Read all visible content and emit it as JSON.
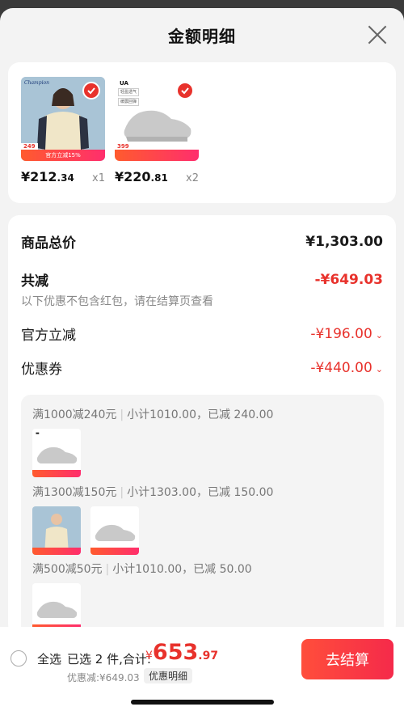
{
  "header": {
    "title": "金额明细"
  },
  "products": [
    {
      "brand": "Champion",
      "tag_price": "249",
      "tag_promo": "官方立减15%",
      "price_int": "¥212",
      "price_dec": ".34",
      "qty": "x1"
    },
    {
      "brand": "UA",
      "small_tags": [
        "轻盈透气",
        "缓震回弹"
      ],
      "tag_price": "399",
      "price_int": "¥220",
      "price_dec": ".81",
      "qty": "x2"
    }
  ],
  "summary": {
    "total_label": "商品总价",
    "total_value": "¥1,303.00",
    "reduce_label": "共减",
    "reduce_value": "-¥649.03",
    "note": "以下优惠不包含红包，请在结算页查看",
    "official_label": "官方立减",
    "official_value": "-¥196.00",
    "coupon_label": "优惠券",
    "coupon_value": "-¥440.00"
  },
  "coupons": [
    {
      "rule": "满1000减240元",
      "detail": "小计1010.00，已减 240.00"
    },
    {
      "rule": "满1300减150元",
      "detail": "小计1303.00，已减 150.00"
    },
    {
      "rule": "满500减50元",
      "detail": "小计1010.00，已减 50.00"
    }
  ],
  "bottom": {
    "select_all": "全选",
    "selected": "已选 2 件,合计:",
    "currency": "¥",
    "total_int": "653",
    "total_dec": ".97",
    "discount": "优惠减:¥649.03",
    "discount_detail": "优惠明细",
    "checkout": "去结算"
  },
  "colors": {
    "accent": "#e8322c",
    "checkout": "#f52a4a"
  }
}
